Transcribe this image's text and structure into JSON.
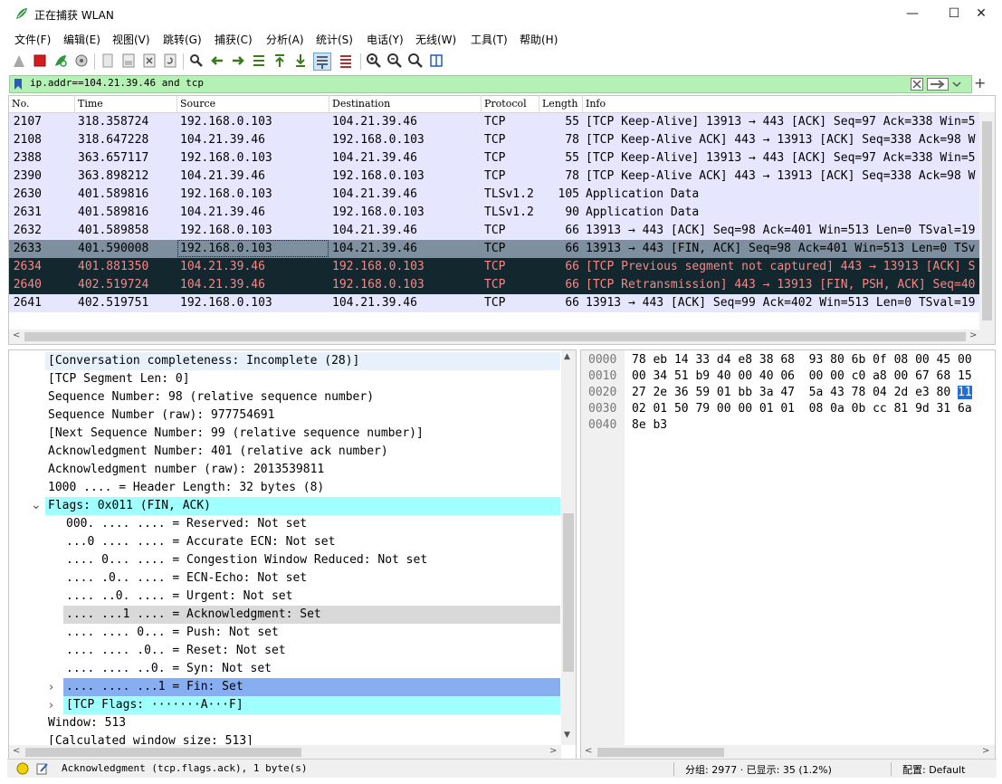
{
  "window": {
    "title": "正在捕获 WLAN",
    "controls": {
      "minimize": "—",
      "maximize": "☐",
      "close": "✕"
    }
  },
  "menu": [
    "文件(F)",
    "编辑(E)",
    "视图(V)",
    "跳转(G)",
    "捕获(C)",
    "分析(A)",
    "统计(S)",
    "电话(Y)",
    "无线(W)",
    "工具(T)",
    "帮助(H)"
  ],
  "filter": {
    "text": "ip.addr==104.21.39.46 and tcp"
  },
  "packets": {
    "columns": [
      "No.",
      "Time",
      "Source",
      "Destination",
      "Protocol",
      "Length",
      "Info"
    ],
    "rows": [
      {
        "no": "2107",
        "time": "318.358724",
        "src": "192.168.0.103",
        "dst": "104.21.39.46",
        "proto": "TCP",
        "len": "55",
        "info": "[TCP Keep-Alive] 13913 → 443 [ACK] Seq=97 Ack=338 Win=5",
        "style": "normal"
      },
      {
        "no": "2108",
        "time": "318.647228",
        "src": "104.21.39.46",
        "dst": "192.168.0.103",
        "proto": "TCP",
        "len": "78",
        "info": "[TCP Keep-Alive ACK] 443 → 13913 [ACK] Seq=338 Ack=98 W",
        "style": "normal"
      },
      {
        "no": "2388",
        "time": "363.657117",
        "src": "192.168.0.103",
        "dst": "104.21.39.46",
        "proto": "TCP",
        "len": "55",
        "info": "[TCP Keep-Alive] 13913 → 443 [ACK] Seq=97 Ack=338 Win=5",
        "style": "normal"
      },
      {
        "no": "2390",
        "time": "363.898212",
        "src": "104.21.39.46",
        "dst": "192.168.0.103",
        "proto": "TCP",
        "len": "78",
        "info": "[TCP Keep-Alive ACK] 443 → 13913 [ACK] Seq=338 Ack=98 W",
        "style": "normal"
      },
      {
        "no": "2630",
        "time": "401.589816",
        "src": "192.168.0.103",
        "dst": "104.21.39.46",
        "proto": "TLSv1.2",
        "len": "105",
        "info": "Application Data",
        "style": "normal"
      },
      {
        "no": "2631",
        "time": "401.589816",
        "src": "104.21.39.46",
        "dst": "192.168.0.103",
        "proto": "TLSv1.2",
        "len": "90",
        "info": "Application Data",
        "style": "normal"
      },
      {
        "no": "2632",
        "time": "401.589858",
        "src": "192.168.0.103",
        "dst": "104.21.39.46",
        "proto": "TCP",
        "len": "66",
        "info": "13913 → 443 [ACK] Seq=98 Ack=401 Win=513 Len=0 TSval=19",
        "style": "normal"
      },
      {
        "no": "2633",
        "time": "401.590008",
        "src": "192.168.0.103",
        "dst": "104.21.39.46",
        "proto": "TCP",
        "len": "66",
        "info": "13913 → 443 [FIN, ACK] Seq=98 Ack=401 Win=513 Len=0 TSv",
        "style": "selected"
      },
      {
        "no": "2634",
        "time": "401.881350",
        "src": "104.21.39.46",
        "dst": "192.168.0.103",
        "proto": "TCP",
        "len": "66",
        "info": "[TCP Previous segment not captured] 443 → 13913 [ACK] S",
        "style": "bad"
      },
      {
        "no": "2640",
        "time": "402.519724",
        "src": "104.21.39.46",
        "dst": "192.168.0.103",
        "proto": "TCP",
        "len": "66",
        "info": "[TCP Retransmission] 443 → 13913 [FIN, PSH, ACK] Seq=40",
        "style": "bad"
      },
      {
        "no": "2641",
        "time": "402.519751",
        "src": "192.168.0.103",
        "dst": "104.21.39.46",
        "proto": "TCP",
        "len": "66",
        "info": "13913 → 443 [ACK] Seq=99 Ack=402 Win=513 Len=0 TSval=19",
        "style": "normal"
      }
    ]
  },
  "details": {
    "lines": [
      {
        "text": "[Conversation completeness: Incomplete (28)]",
        "indent": 0,
        "style": "first"
      },
      {
        "text": "[TCP Segment Len: 0]",
        "indent": 0
      },
      {
        "text": "Sequence Number: 98    (relative sequence number)",
        "indent": 0
      },
      {
        "text": "Sequence Number (raw): 977754691",
        "indent": 0
      },
      {
        "text": "[Next Sequence Number: 99    (relative sequence number)]",
        "indent": 0
      },
      {
        "text": "Acknowledgment Number: 401    (relative ack number)",
        "indent": 0
      },
      {
        "text": "Acknowledgment number (raw): 2013539811",
        "indent": 0
      },
      {
        "text": "1000 .... = Header Length: 32 bytes (8)",
        "indent": 0
      },
      {
        "text": "Flags: 0x011 (FIN, ACK)",
        "indent": 0,
        "arrow": "expanded",
        "style": "cyan"
      },
      {
        "text": "000. .... .... = Reserved: Not set",
        "indent": 1
      },
      {
        "text": "...0 .... .... = Accurate ECN: Not set",
        "indent": 1
      },
      {
        "text": ".... 0... .... = Congestion Window Reduced: Not set",
        "indent": 1
      },
      {
        "text": ".... .0.. .... = ECN-Echo: Not set",
        "indent": 1
      },
      {
        "text": ".... ..0. .... = Urgent: Not set",
        "indent": 1
      },
      {
        "text": ".... ...1 .... = Acknowledgment: Set",
        "indent": 1,
        "style": "gray"
      },
      {
        "text": ".... .... 0... = Push: Not set",
        "indent": 1
      },
      {
        "text": ".... .... .0.. = Reset: Not set",
        "indent": 1
      },
      {
        "text": ".... .... ..0. = Syn: Not set",
        "indent": 1
      },
      {
        "text": ".... .... ...1 = Fin: Set",
        "indent": 1,
        "arrow": "collapsed",
        "style": "blue"
      },
      {
        "text": "[TCP Flags: ·······A···F]",
        "indent": 1,
        "arrow": "collapsed",
        "style": "cyan"
      },
      {
        "text": "Window: 513",
        "indent": 0
      },
      {
        "text": "[Calculated window size: 513]",
        "indent": 0
      }
    ]
  },
  "bytes": {
    "rows": [
      {
        "offset": "0000",
        "hex": "78 eb 14 33 d4 e8 38 68  93 80 6b 0f 08 00 45 00"
      },
      {
        "offset": "0010",
        "hex": "00 34 51 b9 40 00 40 06  00 00 c0 a8 00 67 68 15"
      },
      {
        "offset": "0020",
        "hex": "27 2e 36 59 01 bb 3a 47  5a 43 78 04 2d e3 80 ",
        "highlight": "11"
      },
      {
        "offset": "0030",
        "hex": "02 01 50 79 00 00 01 01  08 0a 0b cc 81 9d 31 6a"
      },
      {
        "offset": "0040",
        "hex": "8e b3"
      }
    ]
  },
  "status": {
    "field": "Acknowledgment (tcp.flags.ack), 1 byte(s)",
    "packets": "分组: 2977 · 已显示: 35 (1.2%)",
    "profile": "配置: Default"
  },
  "colors": {
    "row_normal": "#e7e6ff",
    "row_selected": "#7e8fa0",
    "row_bad_bg": "#12272e",
    "row_bad_fg": "#f78787",
    "detail_cyan": "#a0ffff",
    "detail_blue": "#87aef1",
    "filter_bg": "#b5f0b5"
  }
}
